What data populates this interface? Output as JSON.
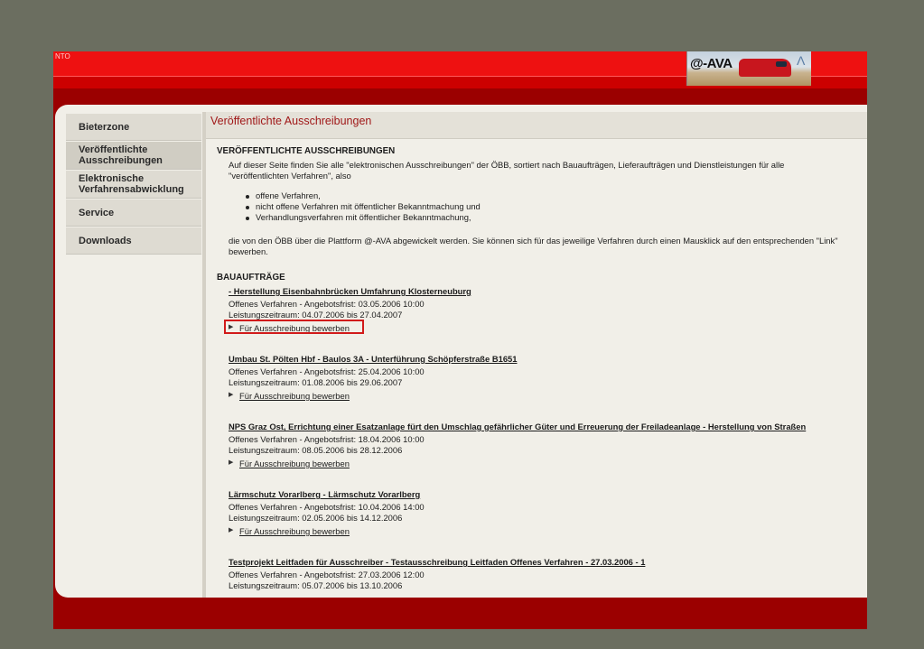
{
  "header": {
    "corner_fragment": "NTO",
    "logo_text": "@-AVA",
    "logo_mark": "Λ"
  },
  "sidebar": {
    "items": [
      {
        "label": "Bieterzone"
      },
      {
        "label": "Veröffentlichte Ausschreibungen"
      },
      {
        "label": "Elektronische Verfahrensabwicklung"
      },
      {
        "label": "Service"
      },
      {
        "label": "Downloads"
      }
    ]
  },
  "main": {
    "page_title": "Veröffentlichte Ausschreibungen",
    "section_heading": "VERÖFFENTLICHTE AUSSCHREIBUNGEN",
    "intro_line1": "Auf dieser Seite finden Sie alle \"elektronischen Ausschreibungen\" der ÖBB, sortiert nach Bauaufträgen, Lieferaufträgen und Dienstleistungen für alle",
    "intro_line2": "\"veröffentlichten Verfahren\", also",
    "bullets": [
      "offene Verfahren,",
      "nicht offene Verfahren mit öffentlicher Bekanntmachung und",
      "Verhandlungsverfahren mit öffentlicher Bekanntmachung,"
    ],
    "outro_line1": "die von den ÖBB über die Plattform @-AVA abgewickelt werden. Sie können sich für das jeweilige Verfahren durch einen Mausklick auf den entsprechenden \"Link\"",
    "outro_line2": "bewerben.",
    "category_heading": "BAUAUFTRÄGE",
    "apply_label": "Für Ausschreibung bewerben",
    "tenders": [
      {
        "title": "- Herstellung Eisenbahnbrücken Umfahrung Klosterneuburg",
        "deadline": "Offenes Verfahren - Angebotsfrist:   03.05.2006 10:00",
        "period": "Leistungszeitraum: 04.07.2006 bis 27.04.2007"
      },
      {
        "title": "Umbau St. Pölten Hbf - Baulos 3A - Unterführung Schöpferstraße B1651",
        "deadline": "Offenes Verfahren - Angebotsfrist:   25.04.2006 10:00",
        "period": "Leistungszeitraum: 01.08.2006 bis 29.06.2007"
      },
      {
        "title": "NPS Graz Ost, Errichtung einer Esatzanlage fürt den Umschlag gefährlicher Güter und Erreuerung der Freiladeanlage - Herstellung von Straßen",
        "deadline": "Offenes Verfahren - Angebotsfrist:   18.04.2006 10:00",
        "period": "Leistungszeitraum: 08.05.2006 bis 28.12.2006"
      },
      {
        "title": "Lärmschutz Vorarlberg - Lärmschutz Vorarlberg",
        "deadline": "Offenes Verfahren - Angebotsfrist:   10.04.2006 14:00",
        "period": "Leistungszeitraum: 02.05.2006 bis 14.12.2006"
      },
      {
        "title": "Testprojekt Leitfaden für Ausschreiber - Testausschreibung Leitfaden Offenes Verfahren - 27.03.2006 - 1",
        "deadline": "Offenes Verfahren - Angebotsfrist:   27.03.2006 12:00",
        "period": "Leistungszeitraum: 05.07.2006 bis 13.10.2006"
      }
    ]
  },
  "colors": {
    "brand_red": "#ee1111",
    "frame_red": "#9b0000",
    "title_red": "#a01818",
    "highlight": "#d11a1a"
  }
}
